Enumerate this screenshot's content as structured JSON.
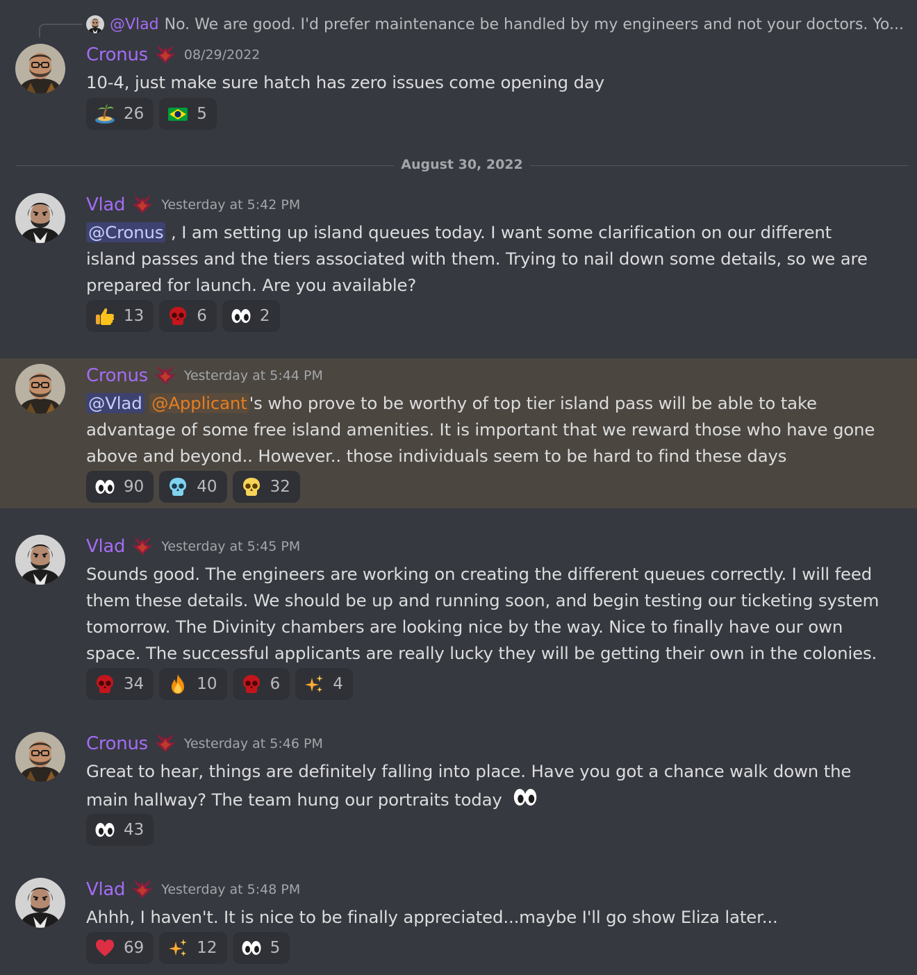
{
  "reply": {
    "user": "@Vlad",
    "text": "No. We are good. I'd prefer maintenance be handled by my engineers and not your doctors.  Yo..."
  },
  "date_divider": "August 30, 2022",
  "messages": [
    {
      "user": "Cronus",
      "timestamp": "08/29/2022",
      "lines": [
        "10-4, just make sure hatch has zero issues come opening day"
      ],
      "reactions": [
        {
          "emoji": "desert-island-emoji",
          "count": "26"
        },
        {
          "emoji": "brazil-flag-emoji",
          "count": "5"
        }
      ]
    },
    {
      "user": "Vlad",
      "timestamp": "Yesterday at 5:42 PM",
      "mention": "@Cronus",
      "lines": [
        " , I am setting up island queues today. I want some clarification on our different",
        "island passes and the tiers associated with them. Trying to nail down some details, so we are",
        "prepared for launch. Are you available?"
      ],
      "reactions": [
        {
          "emoji": "thumbs-up-emoji",
          "count": "13"
        },
        {
          "emoji": "red-skull-emoji",
          "count": "6"
        },
        {
          "emoji": "eyes-emoji",
          "count": "2"
        }
      ]
    },
    {
      "user": "Cronus",
      "timestamp": "Yesterday at 5:44 PM",
      "mention": "@Vlad",
      "role_mention": "@Applicant",
      "lines": [
        "'s who prove to be worthy of top tier island pass will be able to take",
        "advantage of some free island amenities. It is important that we reward those who have gone",
        "above and beyond.. However.. those individuals seem to be hard to find these days"
      ],
      "reactions": [
        {
          "emoji": "eyes-emoji",
          "count": "90"
        },
        {
          "emoji": "blue-skull-emoji",
          "count": "40"
        },
        {
          "emoji": "yellow-skull-emoji",
          "count": "32"
        }
      ]
    },
    {
      "user": "Vlad",
      "timestamp": "Yesterday at 5:45 PM",
      "lines": [
        "Sounds good. The engineers are working on creating the different queues correctly. I will feed",
        "them these details. We should be up and running soon, and begin testing our ticketing system",
        "tomorrow. The Divinity chambers are looking nice by the way. Nice to finally have our own",
        "space. The successful applicants are really lucky they will be getting their own in the colonies."
      ],
      "reactions": [
        {
          "emoji": "red-skull-emoji",
          "count": "34"
        },
        {
          "emoji": "fire-emoji",
          "count": "10"
        },
        {
          "emoji": "red-skull-emoji",
          "count": "6"
        },
        {
          "emoji": "sparkles-emoji",
          "count": "4"
        }
      ]
    },
    {
      "user": "Cronus",
      "timestamp": "Yesterday at 5:46 PM",
      "lines": [
        "Great to hear, things are definitely falling into place. Have you got a chance walk down the",
        "main hallway? The team hung our portraits today"
      ],
      "inline_emoji": "eyes-emoji",
      "reactions": [
        {
          "emoji": "eyes-emoji",
          "count": "43"
        }
      ]
    },
    {
      "user": "Vlad",
      "timestamp": "Yesterday at 5:48 PM",
      "lines": [
        "Ahhh, I haven't. It is nice to be finally appreciated...maybe I'll go show Eliza later..."
      ],
      "reactions": [
        {
          "emoji": "red-heart-emoji",
          "count": "69"
        },
        {
          "emoji": "sparkles-emoji",
          "count": "12"
        },
        {
          "emoji": "eyes-emoji",
          "count": "5"
        }
      ]
    }
  ]
}
